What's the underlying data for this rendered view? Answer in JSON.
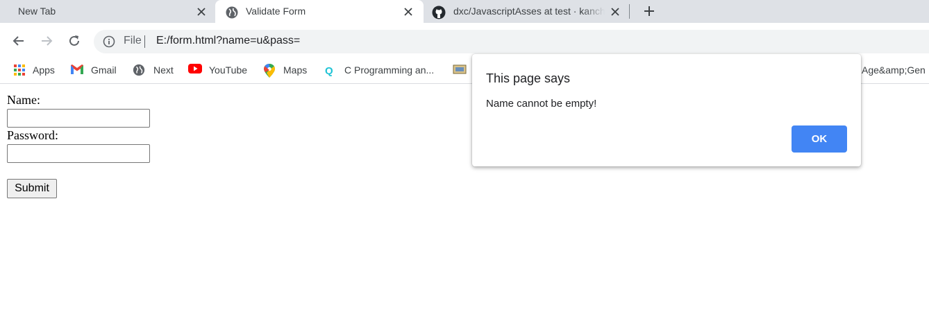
{
  "tabs": [
    {
      "title": "New Tab",
      "active": false
    },
    {
      "title": "Validate Form",
      "active": true
    },
    {
      "title": "dxc/JavascriptAsses at test · kanchan",
      "active": false
    }
  ],
  "omnibox": {
    "scheme_label": "File",
    "url": "E:/form.html?name=u&pass="
  },
  "bookmarks": [
    {
      "label": "Apps",
      "icon": "apps-grid-icon"
    },
    {
      "label": "Gmail",
      "icon": "gmail-icon"
    },
    {
      "label": "Next",
      "icon": "globe-icon"
    },
    {
      "label": "YouTube",
      "icon": "youtube-icon"
    },
    {
      "label": "Maps",
      "icon": "maps-icon"
    },
    {
      "label": "C Programming an...",
      "icon": "q-icon"
    },
    {
      "label": "Age&amp;Gen",
      "icon": ""
    }
  ],
  "form": {
    "name_label": "Name:",
    "password_label": "Password:",
    "name_value": "",
    "password_value": "",
    "submit_label": "Submit"
  },
  "dialog": {
    "title": "This page says",
    "message": "Name cannot be empty!",
    "ok_label": "OK"
  },
  "colors": {
    "accent": "#4285f4",
    "tabstrip_bg": "#dee1e6",
    "omnibox_bg": "#f1f3f4"
  }
}
